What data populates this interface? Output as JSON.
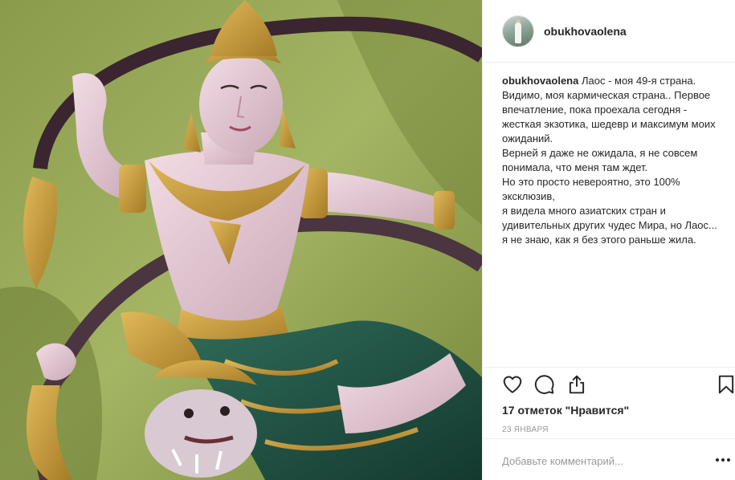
{
  "post": {
    "username": "obukhovaolena",
    "avatar_icon": "avatar-photo",
    "photo": {
      "description_icon": "statue-photo"
    },
    "caption": {
      "author": "obukhovaolena",
      "text": " Лаос - моя 49-я страна. Видимо, моя кармическая страна.. Первое впечатление, пока проехала сегодня - жесткая экзотика, шедевр и максимум моих ожиданий.\nВерней я даже не ожидала, я не совсем понимала, что меня там ждет.\nНо это просто невероятно, это 100% эксклюзив,\nя видела много азиатских стран и удивительных других чудес Мира, но Лаос...\nя не знаю, как я без этого раньше жила."
    },
    "actions": {
      "like_icon": "heart-icon",
      "comment_icon": "comment-icon",
      "share_icon": "share-icon",
      "save_icon": "bookmark-icon"
    },
    "likes_text": "17 отметок \"Нравится\"",
    "date": "23 ЯНВАРЯ",
    "comment_placeholder": "Добавьте комментарий...",
    "more_icon": "more-options-icon"
  }
}
